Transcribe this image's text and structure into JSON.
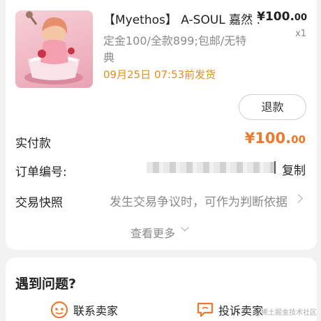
{
  "product": {
    "title": "【Myethos】 A-SOUL 嘉然 ...",
    "price_main": "¥100.",
    "price_cents": "00",
    "quantity": "x1",
    "spec": "定金100/全款899;包邮/无特典",
    "ship_time": "09月25日 07:53前发货",
    "refund_label": "退款"
  },
  "order": {
    "paid_label": "实付款",
    "paid_main": "¥100.",
    "paid_cents": "00",
    "order_no_label": "订单编号:",
    "copy_label": "复制",
    "snapshot_label": "交易快照",
    "snapshot_text": "发生交易争议时，可作为判断依据",
    "more_label": "查看更多"
  },
  "help": {
    "title": "遇到问题?",
    "contact_seller": "联系卖家",
    "complain_seller": "投诉卖家"
  },
  "watermark": "@稀土掘金技术社区",
  "colors": {
    "accent": "#f0782a",
    "ship": "#e0901e"
  }
}
